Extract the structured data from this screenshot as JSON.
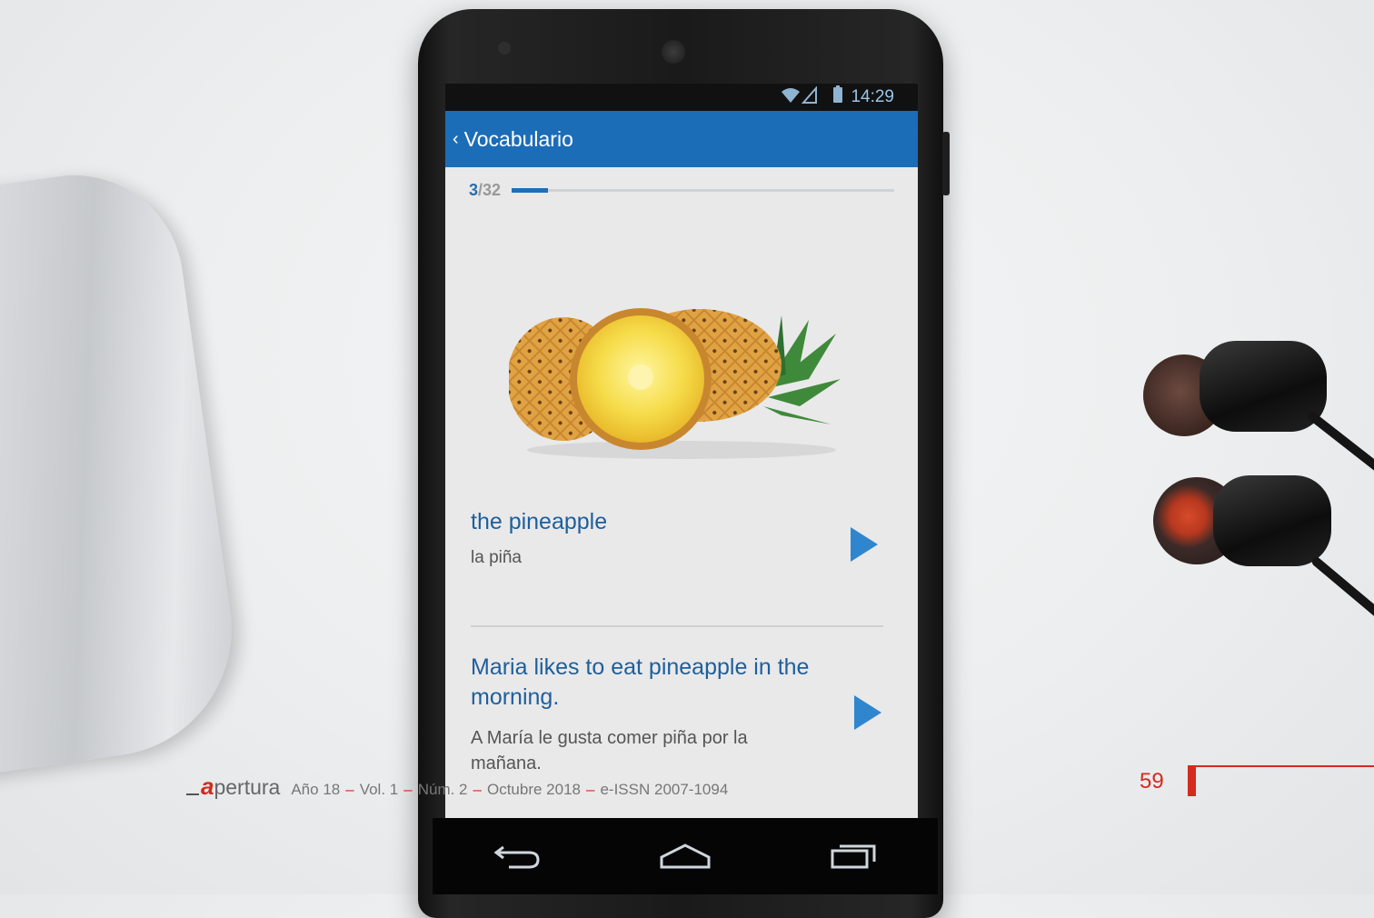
{
  "status_bar": {
    "time": "14:29",
    "signal_icon": "wifi-signal-icon",
    "battery_icon": "battery-icon"
  },
  "app_bar": {
    "back_glyph": "‹",
    "title": "Vocabulario"
  },
  "progress": {
    "current": "3",
    "total": "/32",
    "fraction": 0.094
  },
  "card": {
    "image_icon": "pineapple-image",
    "word": "the pineapple",
    "word_translation": "la piña",
    "sentence": "Maria likes to eat pineapple in the morning.",
    "sentence_translation": "A María le gusta comer piña por la mañana."
  },
  "navigation": {
    "back": "back-icon",
    "home": "home-icon",
    "recents": "recents-icon"
  },
  "footer": {
    "logo_a": "a",
    "logo_rest": "pertura",
    "year": "Año 18",
    "vol": "Vol. 1",
    "num": "Núm. 2",
    "date": "Octubre 2018",
    "issn": "e-ISSN 2007-1094",
    "dash": "–",
    "page": "59"
  },
  "colors": {
    "accent": "#1c6db8",
    "play": "#2f86cf",
    "brand_red": "#d42a1f"
  }
}
